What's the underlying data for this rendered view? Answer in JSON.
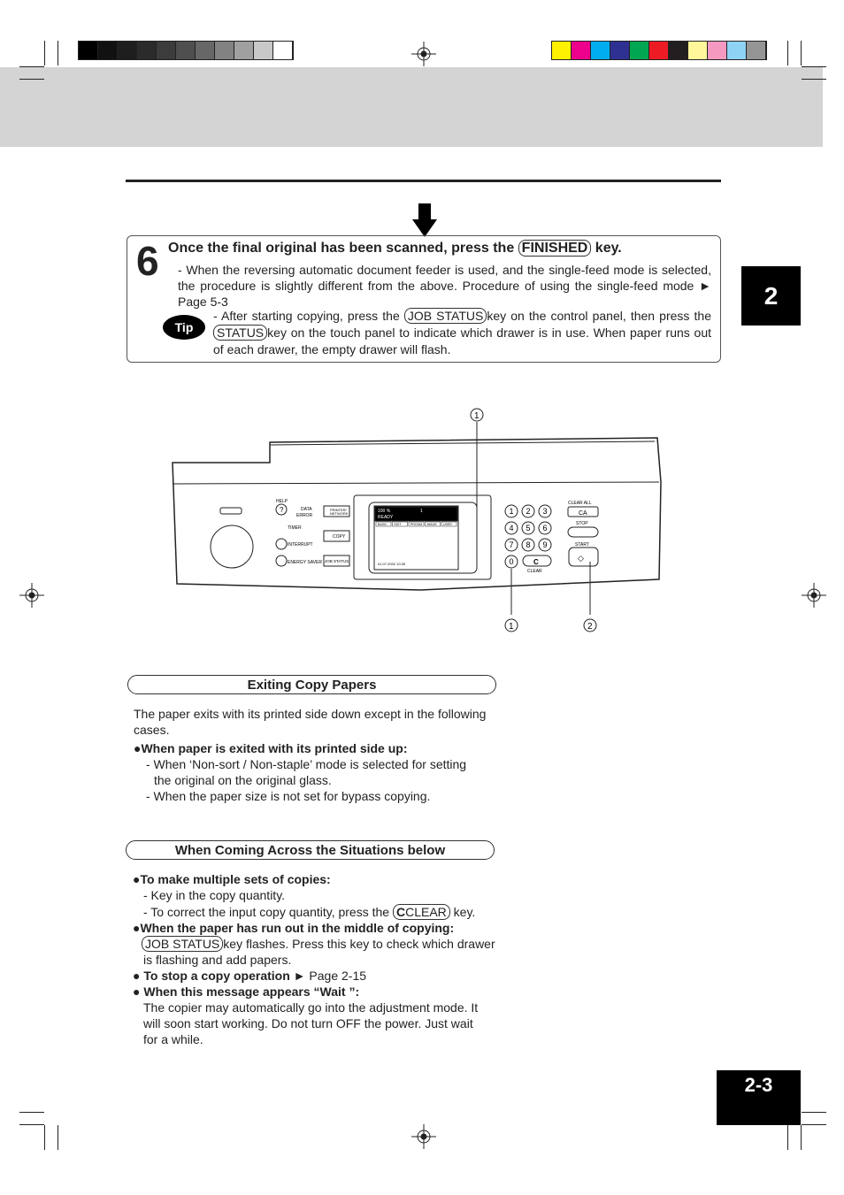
{
  "colors": {
    "grayscale": [
      "#000000",
      "#111111",
      "#1e1e1e",
      "#2b2b2b",
      "#3c3c3c",
      "#4f4f4f",
      "#676767",
      "#828282",
      "#a0a0a0",
      "#c8c8c8",
      "#ffffff"
    ],
    "process": [
      "#fff200",
      "#ec008c",
      "#00aeef",
      "#2e3192",
      "#00a651",
      "#ed1c24",
      "#231f20",
      "#fff799",
      "#f49ac1",
      "#8fd3f4",
      "#959595"
    ]
  },
  "chapter_tab": "2",
  "page_number": "2-3",
  "step": {
    "number": "6",
    "title_pre": "Once the final original has been scanned, press the",
    "title_key": "FINISHED",
    "title_post": "key.",
    "note": "- When the reversing automatic document feeder is used, and the single-feed mode is selected, the procedure is slightly different from the above. Procedure of using the single-feed mode",
    "note_ref": "Page 5-3",
    "tip_label": "Tip",
    "tip_pre": "- After starting copying, press the",
    "tip_key1": "JOB STATUS",
    "tip_mid": "key on the control panel, then press the",
    "tip_key2": "STATUS",
    "tip_post": "key on the touch panel  to indicate which drawer is in use. When paper runs out of each drawer, the empty drawer will flash."
  },
  "panel": {
    "callout1": "1",
    "callout2": "2",
    "help": "HELP",
    "data": "DATA",
    "error": "ERROR",
    "printer": "PRINTER/",
    "network": "NETWORK",
    "timer": "TIMER",
    "interrupt": "INTERRUPT",
    "energy": "ENERGY SAVER",
    "copy": "COPY",
    "job_status": "JOB STATUS",
    "screen_zoom": "100 %",
    "screen_qty": "1",
    "screen_status": "READY",
    "screen_tabs": [
      "BASIC",
      "EDIT",
      "PROGM",
      "IMAGE",
      "USER"
    ],
    "screen_date": "01.07.2002 10:25",
    "digits": [
      "1",
      "2",
      "3",
      "4",
      "5",
      "6",
      "7",
      "8",
      "9",
      "0"
    ],
    "clear_all": "CLEAR ALL",
    "ca": "CA",
    "stop": "STOP",
    "start": "START",
    "c": "C",
    "clear": "CLEAR"
  },
  "exiting": {
    "header": "Exiting Copy Papers",
    "intro": "The paper exits with its printed side down except in the following cases.",
    "bullet": "When paper is exited with its printed side up:",
    "items": [
      "- When  ‘Non-sort / Non-staple’ mode is selected for setting",
      "the original on the original glass.",
      "- When the paper size is not set for bypass copying."
    ]
  },
  "situations": {
    "header": "When Coming Across the Situations below",
    "b1": "To make multiple sets of copies:",
    "b1_i1": "- Key in the copy quantity.",
    "b1_i2_pre": "- To correct the input copy quantity, press the",
    "b1_key": "CLEAR",
    "b1_i2_post": "key.",
    "b2": "When the paper has run out in the middle of copying:",
    "b2_key": "JOB STATUS",
    "b2_t1": "key flashes. Press this key to check which drawer",
    "b2_t2": "is flashing and add papers.",
    "b3": "To stop a copy operation",
    "b3_ref": "Page 2-15",
    "b4": "When this message appears “Wait ”:",
    "b4_lines": [
      "The copier may automatically go into the adjustment mode.  It",
      "will soon start working.  Do not turn OFF the power.  Just wait",
      "for a while."
    ]
  }
}
